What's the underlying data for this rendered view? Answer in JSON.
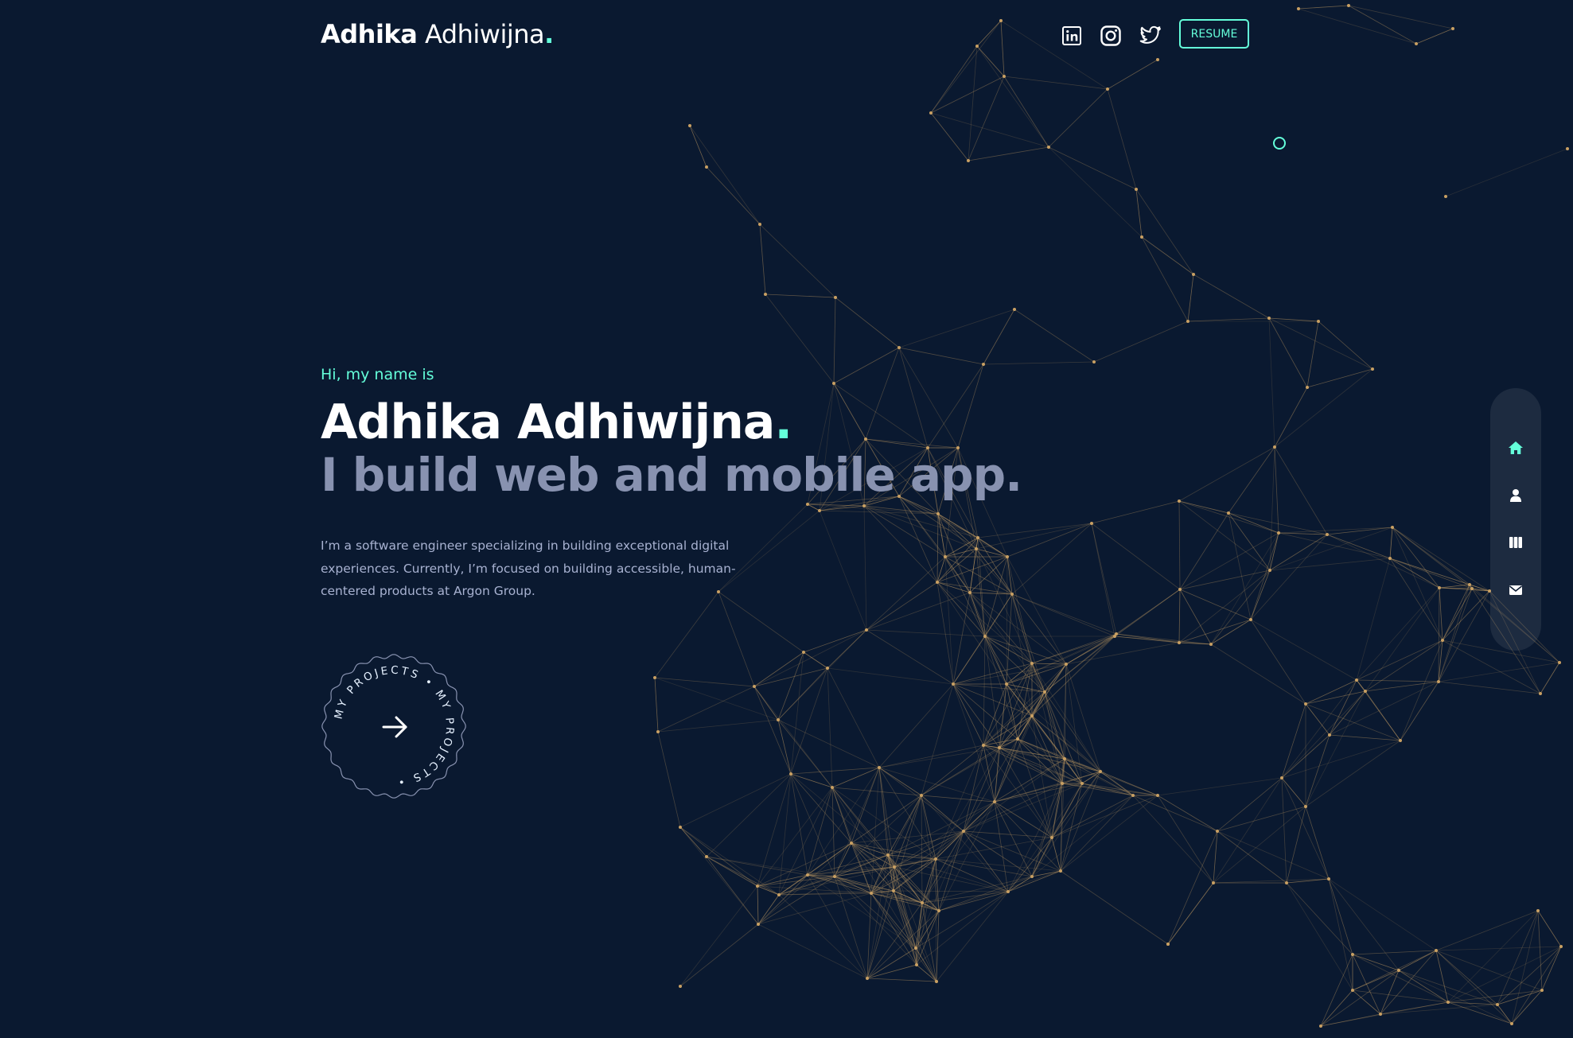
{
  "header": {
    "logo_first": "Adhika",
    "logo_last": "Adhiwijna",
    "logo_dot": ".",
    "social": [
      "linkedin-icon",
      "instagram-icon",
      "twitter-icon"
    ],
    "resume_label": "RESUME"
  },
  "hero": {
    "greeting": "Hi, my name is",
    "name": "Adhika Adhiwijna",
    "name_dot": ".",
    "tagline": "I build web and mobile app.",
    "bio": "I’m a software engineer specializing in building exceptional digital experiences. Currently, I’m focused on building accessible, human-centered products at Argon Group.",
    "projects_badge": {
      "circle_text": "MY PROJECTS • MY PROJECTS • ",
      "icon": "arrow-right-icon"
    }
  },
  "sidenav": {
    "items": [
      {
        "icon": "home-icon",
        "active": true
      },
      {
        "icon": "user-icon",
        "active": false
      },
      {
        "icon": "columns-icon",
        "active": false
      },
      {
        "icon": "mail-icon",
        "active": false
      }
    ]
  },
  "colors": {
    "background": "#0a1930",
    "accent": "#64ffda",
    "network": "#c9a063",
    "muted": "#8892b0"
  }
}
